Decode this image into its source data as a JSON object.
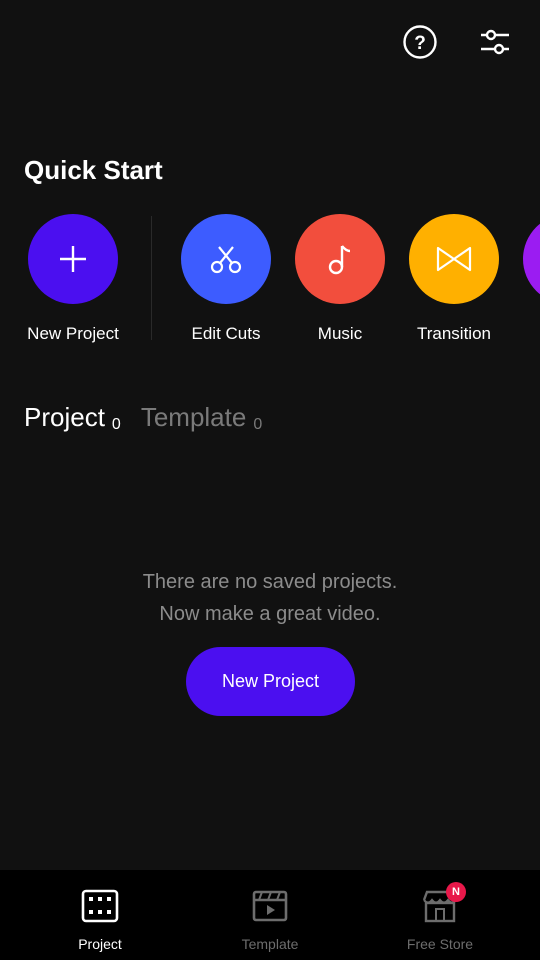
{
  "header": {
    "help_icon": "help-circle-icon",
    "settings_icon": "sliders-icon"
  },
  "quick_start": {
    "title": "Quick Start",
    "items": [
      {
        "label": "New Project",
        "icon": "plus-icon",
        "color": "#4b0ff0"
      },
      {
        "label": "Edit Cuts",
        "icon": "scissors-icon",
        "color": "#3d5cff"
      },
      {
        "label": "Music",
        "icon": "music-note-icon",
        "color": "#f24e3d"
      },
      {
        "label": "Transition",
        "icon": "transition-icon",
        "color": "#ffb000"
      },
      {
        "label": "",
        "icon": "partial-item",
        "color": "#9b1cf2"
      }
    ]
  },
  "tabs": [
    {
      "label": "Project",
      "count": "0",
      "active": true
    },
    {
      "label": "Template",
      "count": "0",
      "active": false
    }
  ],
  "empty_state": {
    "line1": "There are no saved projects.",
    "line2": "Now make a great video."
  },
  "cta": {
    "label": "New Project",
    "color": "#4b0ff0"
  },
  "bottom_nav": [
    {
      "label": "Project",
      "icon": "film-icon",
      "active": true
    },
    {
      "label": "Template",
      "icon": "clapperboard-icon",
      "active": false
    },
    {
      "label": "Free Store",
      "icon": "store-icon",
      "active": false,
      "badge": "N"
    }
  ]
}
